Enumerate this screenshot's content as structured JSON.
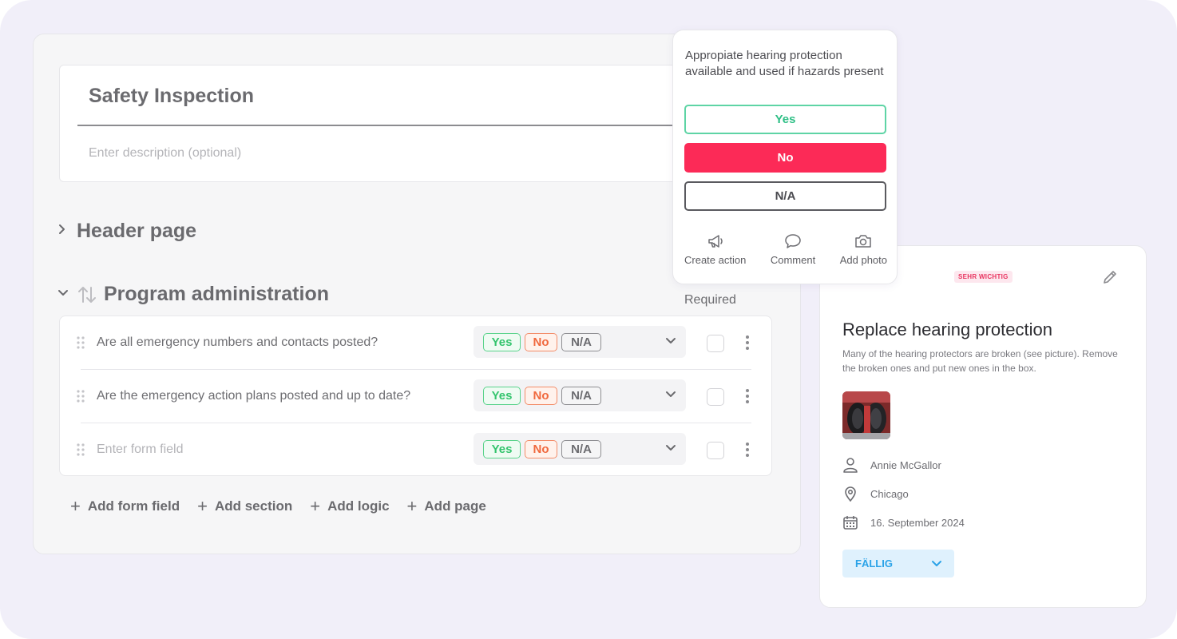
{
  "editor": {
    "form_title": "Safety Inspection",
    "description_placeholder": "Enter description (optional)",
    "header_section": "Header page",
    "program_section": "Program administration",
    "required_label": "Required",
    "fields": [
      {
        "question": "Are all emergency numbers and contacts posted?",
        "is_placeholder": false
      },
      {
        "question": "Are the emergency action plans posted and up to date?",
        "is_placeholder": false
      },
      {
        "question": "Enter form field",
        "is_placeholder": true
      }
    ],
    "answer_options": {
      "yes": "Yes",
      "no": "No",
      "na": "N/A"
    },
    "add_bar": [
      "Add form field",
      "Add section",
      "Add logic",
      "Add page"
    ]
  },
  "popover": {
    "question": "Appropiate hearing protection available and used if hazards present",
    "yes": "Yes",
    "no": "No",
    "na": "N/A",
    "selected": "No",
    "actions": [
      {
        "label": "Create action",
        "icon": "megaphone-icon"
      },
      {
        "label": "Comment",
        "icon": "speech-bubble-icon"
      },
      {
        "label": "Add photo",
        "icon": "camera-icon"
      }
    ]
  },
  "action_card": {
    "priority": "SEHR WICHTIG",
    "title": "Replace hearing protection",
    "description": "Many of the hearing protectors are broken (see picture). Remove the broken ones and put new ones in the box.",
    "assignee": "Annie McGallor",
    "location": "Chicago",
    "due_date": "16. September 2024",
    "status": "FÄLLIG"
  },
  "colors": {
    "background": "#f1eff9",
    "yes_green": "#33c46d",
    "no_orange": "#f0683d",
    "no_red_selected": "#fc2a57",
    "status_blue": "#2ba3e8",
    "priority_pink": "#e8345f"
  }
}
